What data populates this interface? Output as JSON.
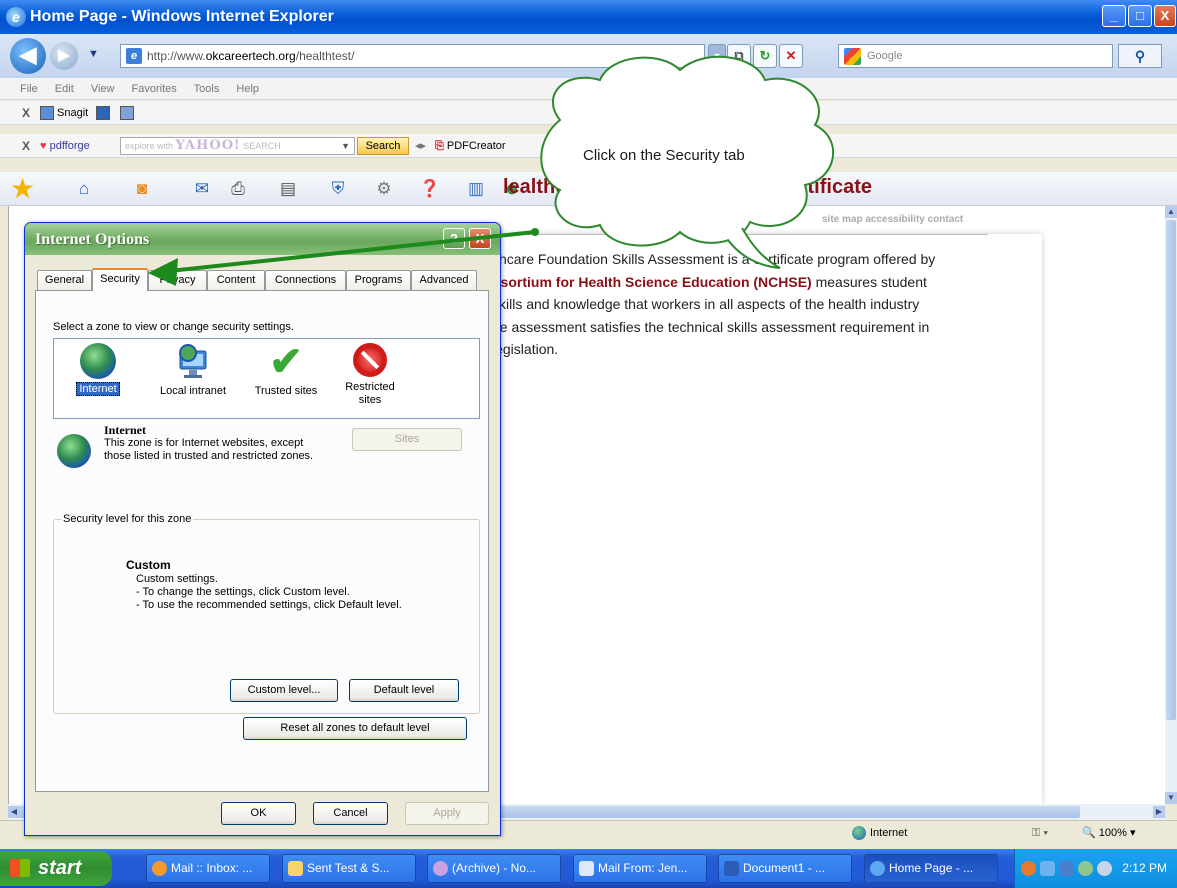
{
  "window": {
    "title": "Home Page - Windows Internet Explorer",
    "min": "_",
    "max": "□",
    "close": "X"
  },
  "address": {
    "url_prefix": "http://www.",
    "url_domain": "okcareertech.org",
    "url_path": "/healthtest/",
    "search_placeholder": "Google"
  },
  "menu": [
    "File",
    "Edit",
    "View",
    "Favorites",
    "Tools",
    "Help"
  ],
  "toolbars": {
    "snagit_label": "Snagit",
    "pdfforge_label": "pdfforge",
    "yahoo_prefix": "explore with",
    "yahoo_brand": "YAHOO!",
    "yahoo_suffix": "SEARCH",
    "yahoo_search_button": "Search",
    "pdfcreator_label": "PDFCreator"
  },
  "page": {
    "site_links": "site map  accessibility  contact",
    "heading": "lealthcare Foundation Skills Certificate",
    "body": [
      {
        "text": "lthcare Foundation Skills Assessment is a certificate program offered by",
        "highlight": ""
      },
      {
        "text": " measures student",
        "highlight": "nsortium for Health Science Education (NCHSE)"
      },
      {
        "text": "skills and knowledge that workers in all aspects of the health industry",
        "highlight": ""
      },
      {
        "text": "ne assessment satisfies the technical skills assessment requirement in",
        "highlight": ""
      },
      {
        "text": "legislation.",
        "highlight": ""
      }
    ]
  },
  "status": {
    "zone": "Internet",
    "zoom": "100%"
  },
  "taskbar": {
    "start_label": "start",
    "items": [
      {
        "label": "Mail :: Inbox: ...",
        "active": false
      },
      {
        "label": "Sent Test & S...",
        "active": false
      },
      {
        "label": "(Archive) - No...",
        "active": false
      },
      {
        "label": "Mail From: Jen...",
        "active": false
      },
      {
        "label": "Document1 - ...",
        "active": false
      },
      {
        "label": "Home Page - ...",
        "active": true
      }
    ],
    "clock": "2:12 PM"
  },
  "dialog": {
    "title": "Internet Options",
    "help": "?",
    "close": "X",
    "tabs": [
      "General",
      "Security",
      "Privacy",
      "Content",
      "Connections",
      "Programs",
      "Advanced"
    ],
    "active_tab": "Security",
    "zone_instruction": "Select a zone to view or change security settings.",
    "zones": [
      {
        "label": "Internet",
        "icon": "globe-icon",
        "selected": true
      },
      {
        "label": "Local intranet",
        "icon": "monitor-globe-icon",
        "selected": false
      },
      {
        "label": "Trusted sites",
        "icon": "check-icon",
        "selected": false
      },
      {
        "label": "Restricted sites",
        "icon": "ban-icon",
        "selected": false
      }
    ],
    "zone_info_name": "Internet",
    "zone_info_desc": "This zone is for Internet websites, except those listed in trusted and restricted zones.",
    "sites_button": "Sites",
    "security_group_label": "Security level for this zone",
    "custom_title": "Custom",
    "custom_lines": [
      "Custom settings.",
      "- To change the settings, click Custom level.",
      "- To use the recommended settings, click Default level."
    ],
    "custom_level_button": "Custom level...",
    "default_level_button": "Default level",
    "reset_button": "Reset all zones to default level",
    "ok_button": "OK",
    "cancel_button": "Cancel",
    "apply_button": "Apply"
  },
  "callout": {
    "text": "Click on the Security tab"
  }
}
